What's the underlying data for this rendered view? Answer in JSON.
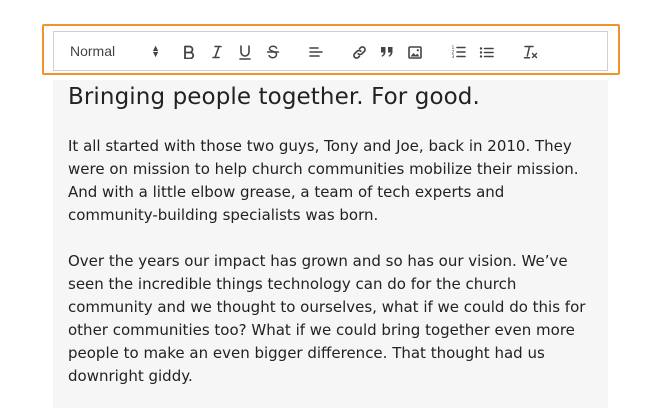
{
  "toolbar": {
    "format_select": {
      "value": "Normal"
    },
    "buttons": [
      {
        "name": "bold",
        "icon": "bold-icon"
      },
      {
        "name": "italic",
        "icon": "italic-icon"
      },
      {
        "name": "underline",
        "icon": "underline-icon"
      },
      {
        "name": "strikethrough",
        "icon": "strikethrough-icon"
      },
      {
        "name": "align",
        "icon": "align-left-icon"
      },
      {
        "name": "link",
        "icon": "link-icon"
      },
      {
        "name": "blockquote",
        "icon": "quote-icon"
      },
      {
        "name": "image",
        "icon": "image-icon"
      },
      {
        "name": "ordered-list",
        "icon": "ordered-list-icon"
      },
      {
        "name": "bullet-list",
        "icon": "bullet-list-icon"
      },
      {
        "name": "clear-format",
        "icon": "clear-format-icon"
      }
    ]
  },
  "editor": {
    "heading": "Bringing people together. For good.",
    "paragraphs": [
      "It all started with those two guys, Tony and Joe, back in 2010. They were on mission to help church communities mobilize their mission. And with a little elbow grease, a team of tech experts and community-building specialists was born.",
      "Over the years our impact has grown and so has our vision. We’ve seen the incredible things technology can do for the church community and we thought to ourselves, what if we could do this for other communities too? What if we could bring together even more people to make an even bigger difference. That thought had us downright giddy."
    ]
  },
  "colors": {
    "highlight_border": "#f0922e",
    "editor_background": "#f6f6f6",
    "toolbar_border": "#cfcfcf",
    "icon_color": "#444444"
  }
}
